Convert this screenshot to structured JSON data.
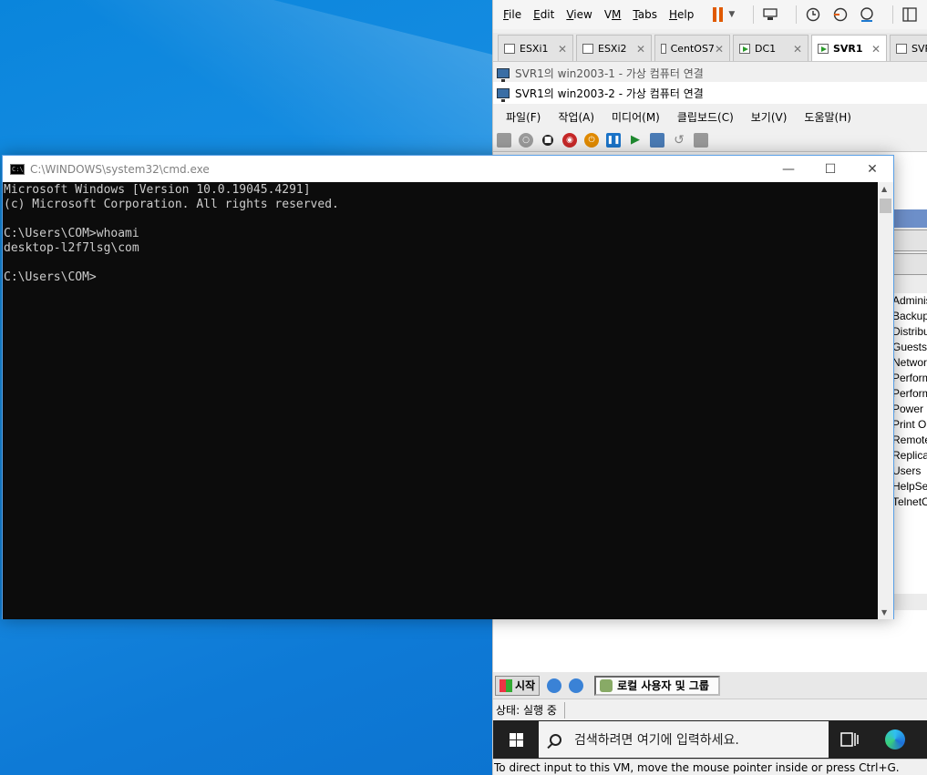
{
  "vmware": {
    "menu": [
      {
        "pre": "",
        "u": "F",
        "post": "ile"
      },
      {
        "pre": "",
        "u": "E",
        "post": "dit"
      },
      {
        "pre": "",
        "u": "V",
        "post": "iew"
      },
      {
        "pre": "V",
        "u": "M",
        "post": ""
      },
      {
        "pre": "",
        "u": "T",
        "post": "abs"
      },
      {
        "pre": "",
        "u": "H",
        "post": "elp"
      }
    ],
    "tabs": [
      {
        "label": "ESXi1",
        "active": false
      },
      {
        "label": "ESXi2",
        "active": false
      },
      {
        "label": "CentOS7",
        "active": false
      },
      {
        "label": "DC1",
        "active": false
      },
      {
        "label": "SVR1",
        "active": true
      },
      {
        "label": "SVR",
        "active": false
      }
    ],
    "vm_conn_title_1": "SVR1의 win2003-1 - 가상 컴퓨터 연결",
    "vm_conn_title_2": "SVR1의 win2003-2 - 가상 컴퓨터 연결",
    "vm_conn_menu": [
      "파일(F)",
      "작업(A)",
      "미디어(M)",
      "클립보드(C)",
      "보기(V)",
      "도움말(H)"
    ],
    "status_bar": "To direct input to this VM, move the mouse pointer inside or press Ctrl+G."
  },
  "guest": {
    "groups": [
      "Administ",
      "Backup",
      "Distribu",
      "Guests",
      "Network",
      "Perform",
      "Perform",
      "Power U",
      "Print Op",
      "Remote",
      "Replica",
      "Users",
      "HelpSer",
      "TelnetC"
    ],
    "start_label": "시작",
    "taskbar_item": "로컬 사용자 및 그룹",
    "status_text": "상태: 실행 중"
  },
  "win10": {
    "search_placeholder": "검색하려면 여기에 입력하세요."
  },
  "cmd": {
    "title": "C:\\WINDOWS\\system32\\cmd.exe",
    "lines": [
      "Microsoft Windows [Version 10.0.19045.4291]",
      "(c) Microsoft Corporation. All rights reserved.",
      "",
      "C:\\Users\\COM>whoami",
      "desktop-l2f7lsg\\com",
      "",
      "C:\\Users\\COM>"
    ]
  }
}
